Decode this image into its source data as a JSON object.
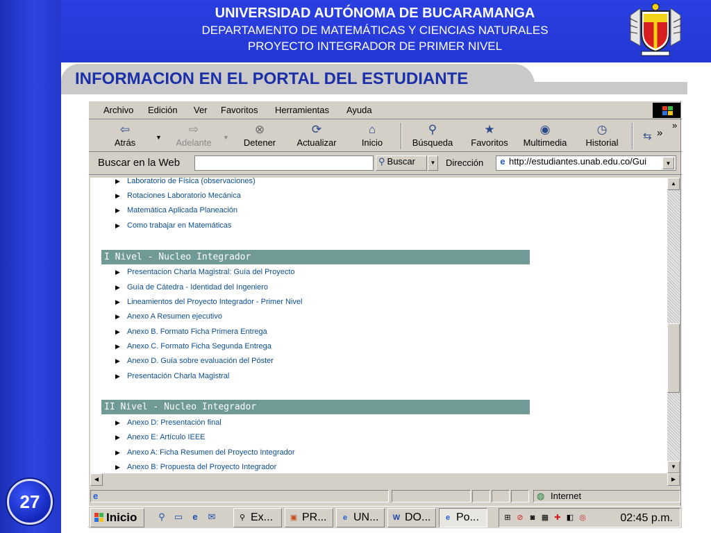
{
  "slide": {
    "header": {
      "university": "UNIVERSIDAD AUTÓNOMA DE BUCARAMANGA",
      "department": "DEPARTAMENTO DE MATEMÁTICAS Y CIENCIAS NATURALES",
      "project": "PROYECTO INTEGRADOR DE PRIMER NIVEL"
    },
    "title": "INFORMACION EN EL PORTAL DEL ESTUDIANTE",
    "page_number": "27",
    "colors": {
      "blue": "#2438d4",
      "title_text": "#1a2fa8",
      "title_bar": "#c9c9c9"
    }
  },
  "browser": {
    "menu": [
      "Archivo",
      "Edición",
      "Ver",
      "Favoritos",
      "Herramientas",
      "Ayuda"
    ],
    "toolbar": {
      "back": "Atrás",
      "forward": "Adelante",
      "stop": "Detener",
      "refresh": "Actualizar",
      "home": "Inicio",
      "search": "Búsqueda",
      "favorites": "Favoritos",
      "media": "Multimedia",
      "history": "Historial",
      "chevron": "»"
    },
    "search_bar": {
      "label": "Buscar en la Web",
      "input_value": "",
      "button": "Buscar"
    },
    "address": {
      "label": "Dirección",
      "url": "http://estudiantes.unab.edu.co/Gui"
    },
    "content": {
      "top_links": [
        "Laboratorio de Física (observaciones)",
        "Rotaciones Laboratorio Mecánica",
        "Matemática Aplicada Planeación",
        "Como trabajar en Matemáticas"
      ],
      "sections": [
        {
          "heading": "I Nivel - Nucleo Integrador",
          "links": [
            "Presentacion Charla Magistral: Guía del Proyecto",
            "Guía de Cátedra - Identidad del Ingeniero",
            "Lineamientos del Proyecto Integrador - Primer Nivel",
            "Anexo A Resumen ejecutivo",
            "Anexo B. Formato Ficha Primera Entrega",
            "Anexo C. Formato Ficha Segunda Entrega",
            "Anexo D. Guía sobre evaluación del Póster",
            "Presentación Charla Magistral"
          ]
        },
        {
          "heading": "II Nivel - Nucleo Integrador",
          "links": [
            "Anexo D: Presentación final",
            "Anexo E: Artículo IEEE",
            "Anexo A: Ficha Resumen del Proyecto Integrador",
            "Anexo B: Propuesta del Proyecto Integrador"
          ]
        }
      ],
      "link_color": "#0b4d8f",
      "section_color": "#6f9a95"
    },
    "status": {
      "zone": "Internet"
    }
  },
  "taskbar": {
    "start": "Inicio",
    "tasks": [
      "Ex...",
      "PR...",
      "UN...",
      "DO...",
      "Po..."
    ],
    "clock": "02:45 p.m."
  }
}
